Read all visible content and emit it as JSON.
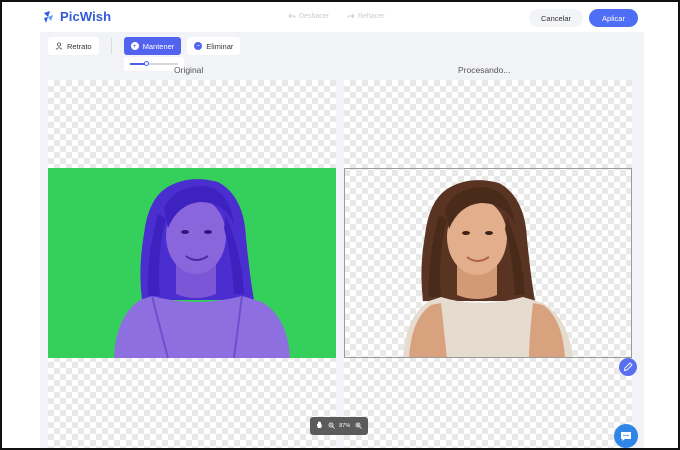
{
  "app": {
    "name": "PicWish",
    "brand_color": "#2f5bd7"
  },
  "header": {
    "undo_label": "Deshacer",
    "redo_label": "Rehacer",
    "cancel_label": "Cancelar",
    "apply_label": "Aplicar",
    "apply_color": "#4d6ef5"
  },
  "toolbar": {
    "portrait_label": "Retrato",
    "keep_label": "Mantener",
    "erase_label": "Eliminar",
    "active_tool": "Mantener",
    "brush_size_fraction": 0.35
  },
  "panes": {
    "original_label": "Original",
    "processing_label": "Procesando..."
  },
  "zoom": {
    "level": "87%"
  },
  "icons": {
    "portrait": "person-icon",
    "keep": "plus-circle-icon",
    "erase": "minus-circle-icon",
    "pan": "hand-icon",
    "zoom_out": "zoom-out-icon",
    "zoom_in": "zoom-in-icon",
    "edit": "edit-bubble-icon",
    "chat": "chat-icon"
  },
  "colors": {
    "green_screen": "#35cf5c",
    "keep_overlay": "#5263ef"
  }
}
